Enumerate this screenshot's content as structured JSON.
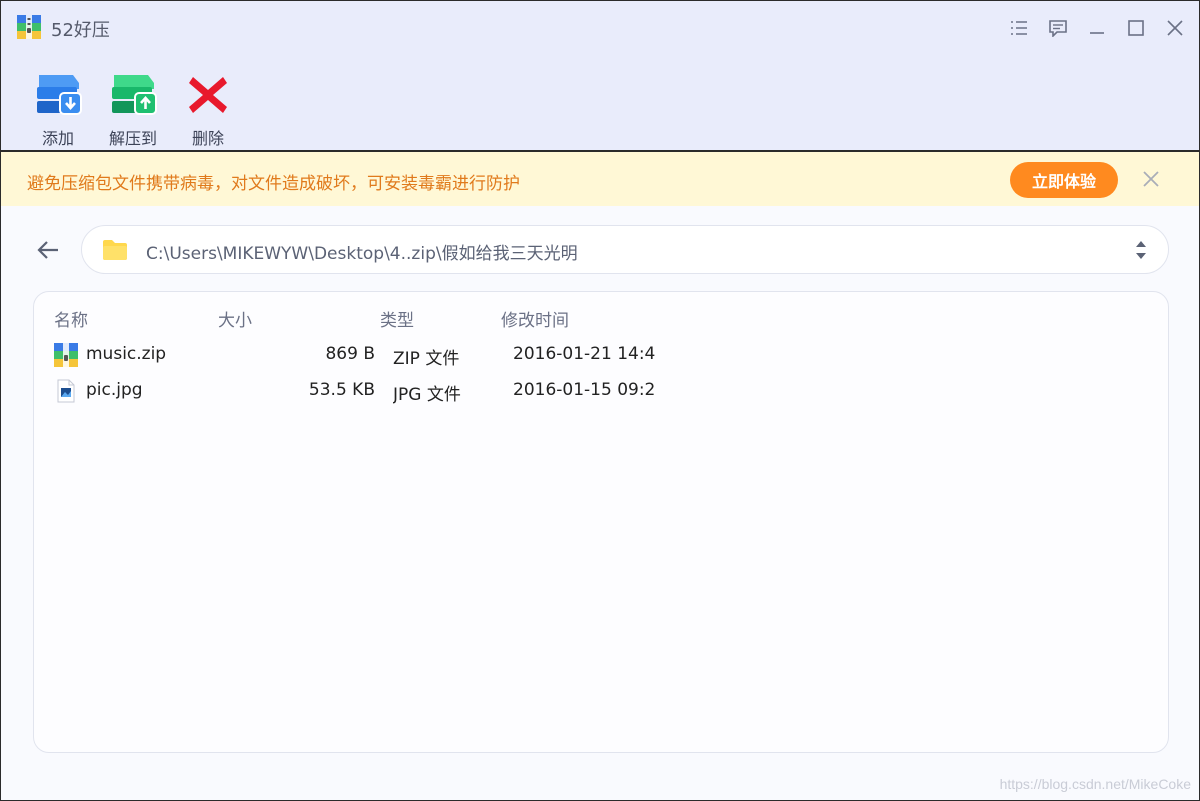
{
  "app": {
    "title": "52好压"
  },
  "toolbar": {
    "add_label": "添加",
    "extract_label": "解压到",
    "delete_label": "删除"
  },
  "banner": {
    "text": "避免压缩包文件携带病毒，对文件造成破坏，可安装毒霸进行防护",
    "button_label": "立即体验"
  },
  "path": {
    "value": "C:\\Users\\MIKEWYW\\Desktop\\4..zip\\假如给我三天光明"
  },
  "file_list": {
    "columns": [
      "名称",
      "大小",
      "类型",
      "修改时间"
    ],
    "rows": [
      {
        "name": "music.zip",
        "size": "869 B",
        "type": "ZIP 文件",
        "modified": "2016-01-21 14:4",
        "icon": "zip-archive-icon"
      },
      {
        "name": "pic.jpg",
        "size": "53.5 KB",
        "type": "JPG 文件",
        "modified": "2016-01-15 09:2",
        "icon": "image-file-icon"
      }
    ]
  },
  "watermark": "https://blog.csdn.net/MikeCoke",
  "colors": {
    "titlebar_bg": "#e9ecfb",
    "banner_bg": "#fff8d6",
    "banner_text": "#e07a1c",
    "accent_orange": "#ff8a1f",
    "delete_red": "#e8192c",
    "add_blue": "#2b7de9",
    "extract_green": "#19b86a"
  }
}
